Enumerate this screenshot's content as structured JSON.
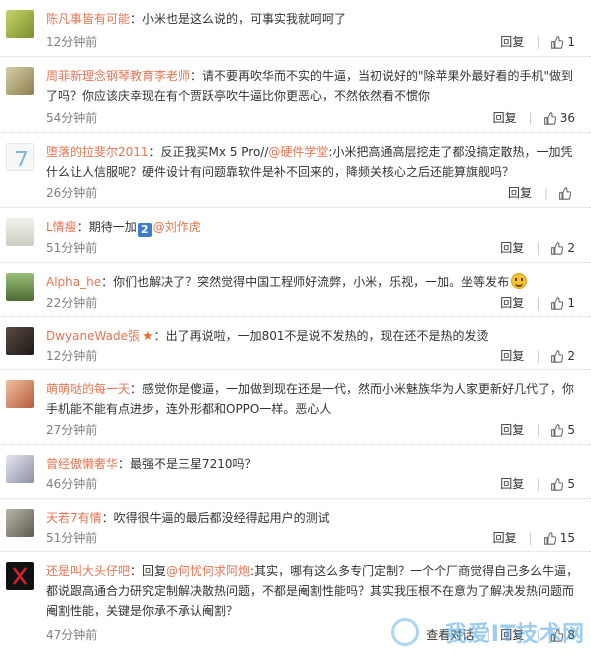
{
  "common": {
    "reply_label": "回复",
    "sep": "|"
  },
  "watermark": "我爱IT技术网",
  "comments": [
    {
      "name": "陈凡事皆有可能",
      "text": "：小米也是这么说的，可事实我就呵呵了",
      "time": "12分钟前",
      "likes": "1"
    },
    {
      "name": "周菲新理念钢琴教育李老师",
      "text": "：请不要再吹华而不实的牛逼，当初说好的\"除苹果外最好看的手机\"做到了吗？你应该庆幸现在有个贾跃亭吹牛逼比你更恶心，不然依然看不惯你",
      "time": "54分钟前",
      "likes": "36"
    },
    {
      "name": "堕落的拉斐尔2011",
      "text_a": "：反正我买Mx 5 Pro//",
      "mention": "@硬件学堂",
      "text_b": ":小米把高通高层挖走了都没搞定散热，一加凭什么让人信服呢？硬件设计有问题靠软件是补不回来的，降频关核心之后还能算旗舰吗？",
      "time": "26分钟前",
      "likes": ""
    },
    {
      "name": "L情瘦",
      "text_a": "：期待一加",
      "num_badge": "2",
      "mention": "@刘作虎",
      "time": "51分钟前",
      "likes": "2"
    },
    {
      "name": "Alpha_he",
      "text": "：你们也解决了？突然觉得中国工程师好流弊，小米，乐视，一加。坐等发布",
      "time": "22分钟前",
      "likes": "1"
    },
    {
      "name": "DwyaneWade張",
      "text": "：出了再说啦，一加801不是说不发热的，现在还不是热的发烫",
      "time": "12分钟前",
      "likes": "2"
    },
    {
      "name": "萌萌哒的每一天",
      "text": "：感觉你是傻逼，一加做到现在还是一代，然而小米魅族华为人家更新好几代了，你手机能不能有点进步，连外形都和OPPO一样。恶心人",
      "time": "27分钟前",
      "likes": "5"
    },
    {
      "name": "曾经傲懒奢华",
      "text": "：最强不是三星7210吗？",
      "time": "46分钟前",
      "likes": "5"
    },
    {
      "name": "天若7有情",
      "text": "：吹得很牛逼的最后都没经得起用户的测试",
      "time": "51分钟前",
      "likes": "15"
    },
    {
      "name": "还是叫大头仔吧",
      "text_a": "：回复",
      "mention": "@何忧何求阿炮",
      "text_b": ":其实，哪有这么多专门定制？一个个厂商觉得自己多么牛逼，都说跟高通合力研究定制解决散热问题，不都是阉割性能吗？其实我压根不在意为了解决发热问题而阉割性能，关键是你承不承认阉割？",
      "time": "47分钟前",
      "view_label": "查看对话",
      "likes": "8"
    }
  ]
}
